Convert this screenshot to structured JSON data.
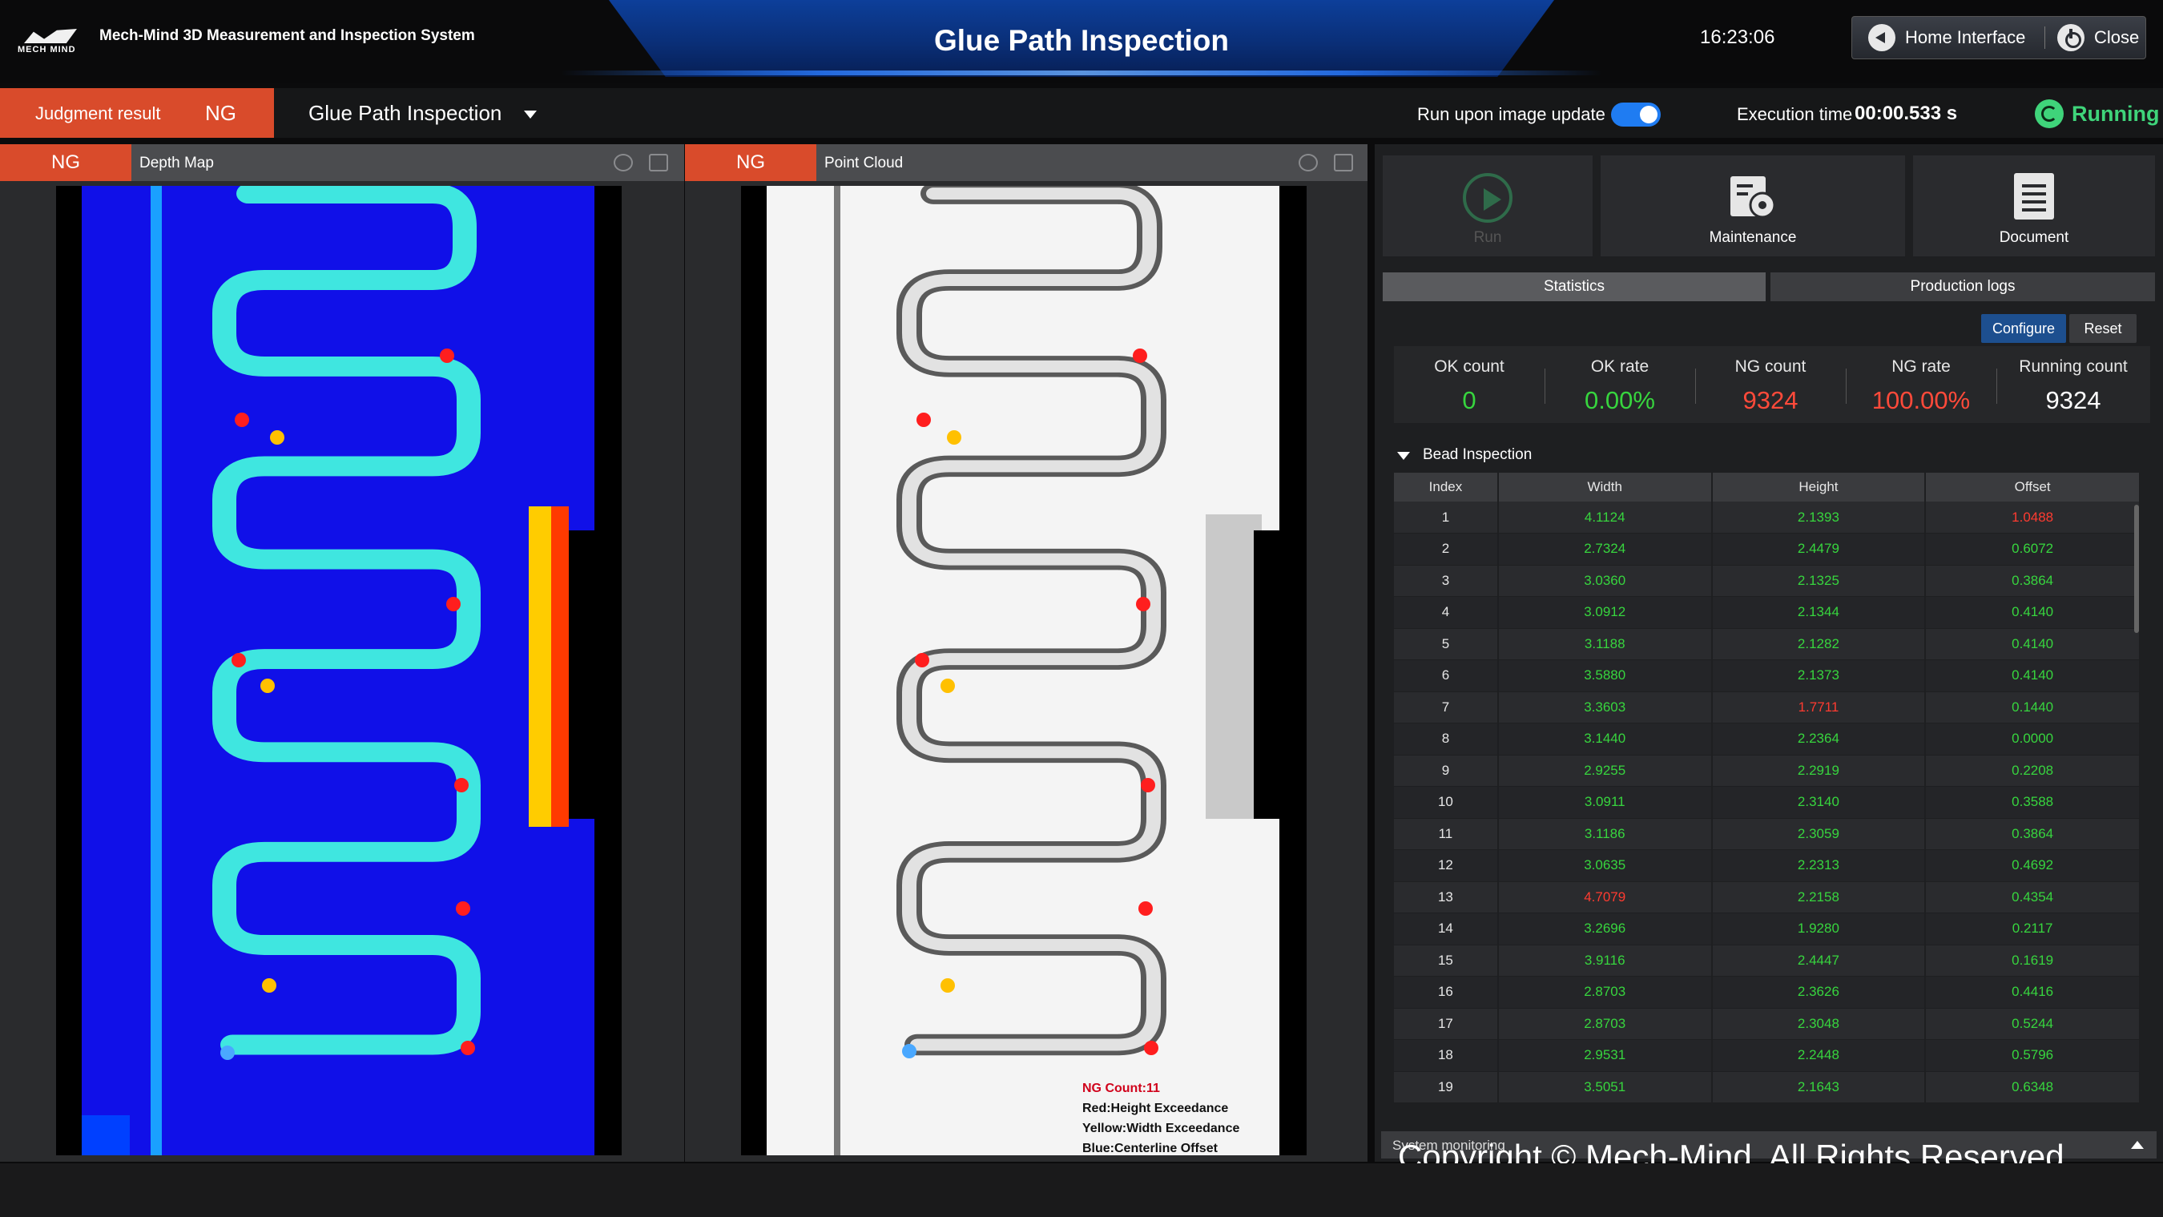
{
  "header": {
    "brand_logo_text": "MECH MIND",
    "app_title": "Mech-Mind 3D Measurement and Inspection System",
    "page_title": "Glue Path Inspection",
    "clock": "16:23:06",
    "home_label": "Home Interface",
    "close_label": "Close"
  },
  "status": {
    "judgment_label": "Judgment result",
    "judgment_value": "NG",
    "project": "Glue Path Inspection",
    "run_update_label": "Run upon image update",
    "run_update_on": true,
    "exec_label": "Execution time",
    "exec_value": "00:00.533 s",
    "state": "Running"
  },
  "viewers": [
    {
      "badge": "NG",
      "title": "Depth Map"
    },
    {
      "badge": "NG",
      "title": "Point Cloud"
    }
  ],
  "overlay_legend": {
    "count": "NG Count:11",
    "red": "Red:Height Exceedance",
    "yellow": "Yellow:Width Exceedance",
    "blue": "Blue:Centerline Offset"
  },
  "tools": {
    "run": "Run",
    "maintenance": "Maintenance",
    "document": "Document"
  },
  "tabs": {
    "statistics": "Statistics",
    "logs": "Production logs"
  },
  "stat_buttons": {
    "configure": "Configure",
    "reset": "Reset"
  },
  "stats": [
    {
      "key": "OK count",
      "value": "0",
      "color": "#37d53e"
    },
    {
      "key": "OK rate",
      "value": "0.00%",
      "color": "#37d53e"
    },
    {
      "key": "NG count",
      "value": "9324",
      "color": "#ff4a3a"
    },
    {
      "key": "NG rate",
      "value": "100.00%",
      "color": "#ff4a3a"
    },
    {
      "key": "Running count",
      "value": "9324",
      "color": "#ffffff"
    }
  ],
  "bead_section": "Bead Inspection",
  "bead_columns": [
    "Index",
    "Width",
    "Height",
    "Offset"
  ],
  "bead_rows": [
    [
      "1",
      "4.1124",
      "2.1393",
      "1.0488"
    ],
    [
      "2",
      "2.7324",
      "2.4479",
      "0.6072"
    ],
    [
      "3",
      "3.0360",
      "2.1325",
      "0.3864"
    ],
    [
      "4",
      "3.0912",
      "2.1344",
      "0.4140"
    ],
    [
      "5",
      "3.1188",
      "2.1282",
      "0.4140"
    ],
    [
      "6",
      "3.5880",
      "2.1373",
      "0.4140"
    ],
    [
      "7",
      "3.3603",
      "1.7711",
      "0.1440"
    ],
    [
      "8",
      "3.1440",
      "2.2364",
      "0.0000"
    ],
    [
      "9",
      "2.9255",
      "2.2919",
      "0.2208"
    ],
    [
      "10",
      "3.0911",
      "2.3140",
      "0.3588"
    ],
    [
      "11",
      "3.1186",
      "2.3059",
      "0.3864"
    ],
    [
      "12",
      "3.0635",
      "2.2313",
      "0.4692"
    ],
    [
      "13",
      "4.7079",
      "2.2158",
      "0.4354"
    ],
    [
      "14",
      "3.2696",
      "1.9280",
      "0.2117"
    ],
    [
      "15",
      "3.9116",
      "2.4447",
      "0.1619"
    ],
    [
      "16",
      "2.8703",
      "2.3626",
      "0.4416"
    ],
    [
      "17",
      "2.8703",
      "2.3048",
      "0.5244"
    ],
    [
      "18",
      "2.9531",
      "2.2448",
      "0.5796"
    ],
    [
      "19",
      "3.5051",
      "2.1643",
      "0.6348"
    ]
  ],
  "bead_ng_cells": {
    "0": [
      3
    ],
    "6": [
      2
    ],
    "12": [
      1
    ]
  },
  "system_monitoring": "System monitoring",
  "copyright": "Copyright © Mech-Mind. All Rights Reserved."
}
